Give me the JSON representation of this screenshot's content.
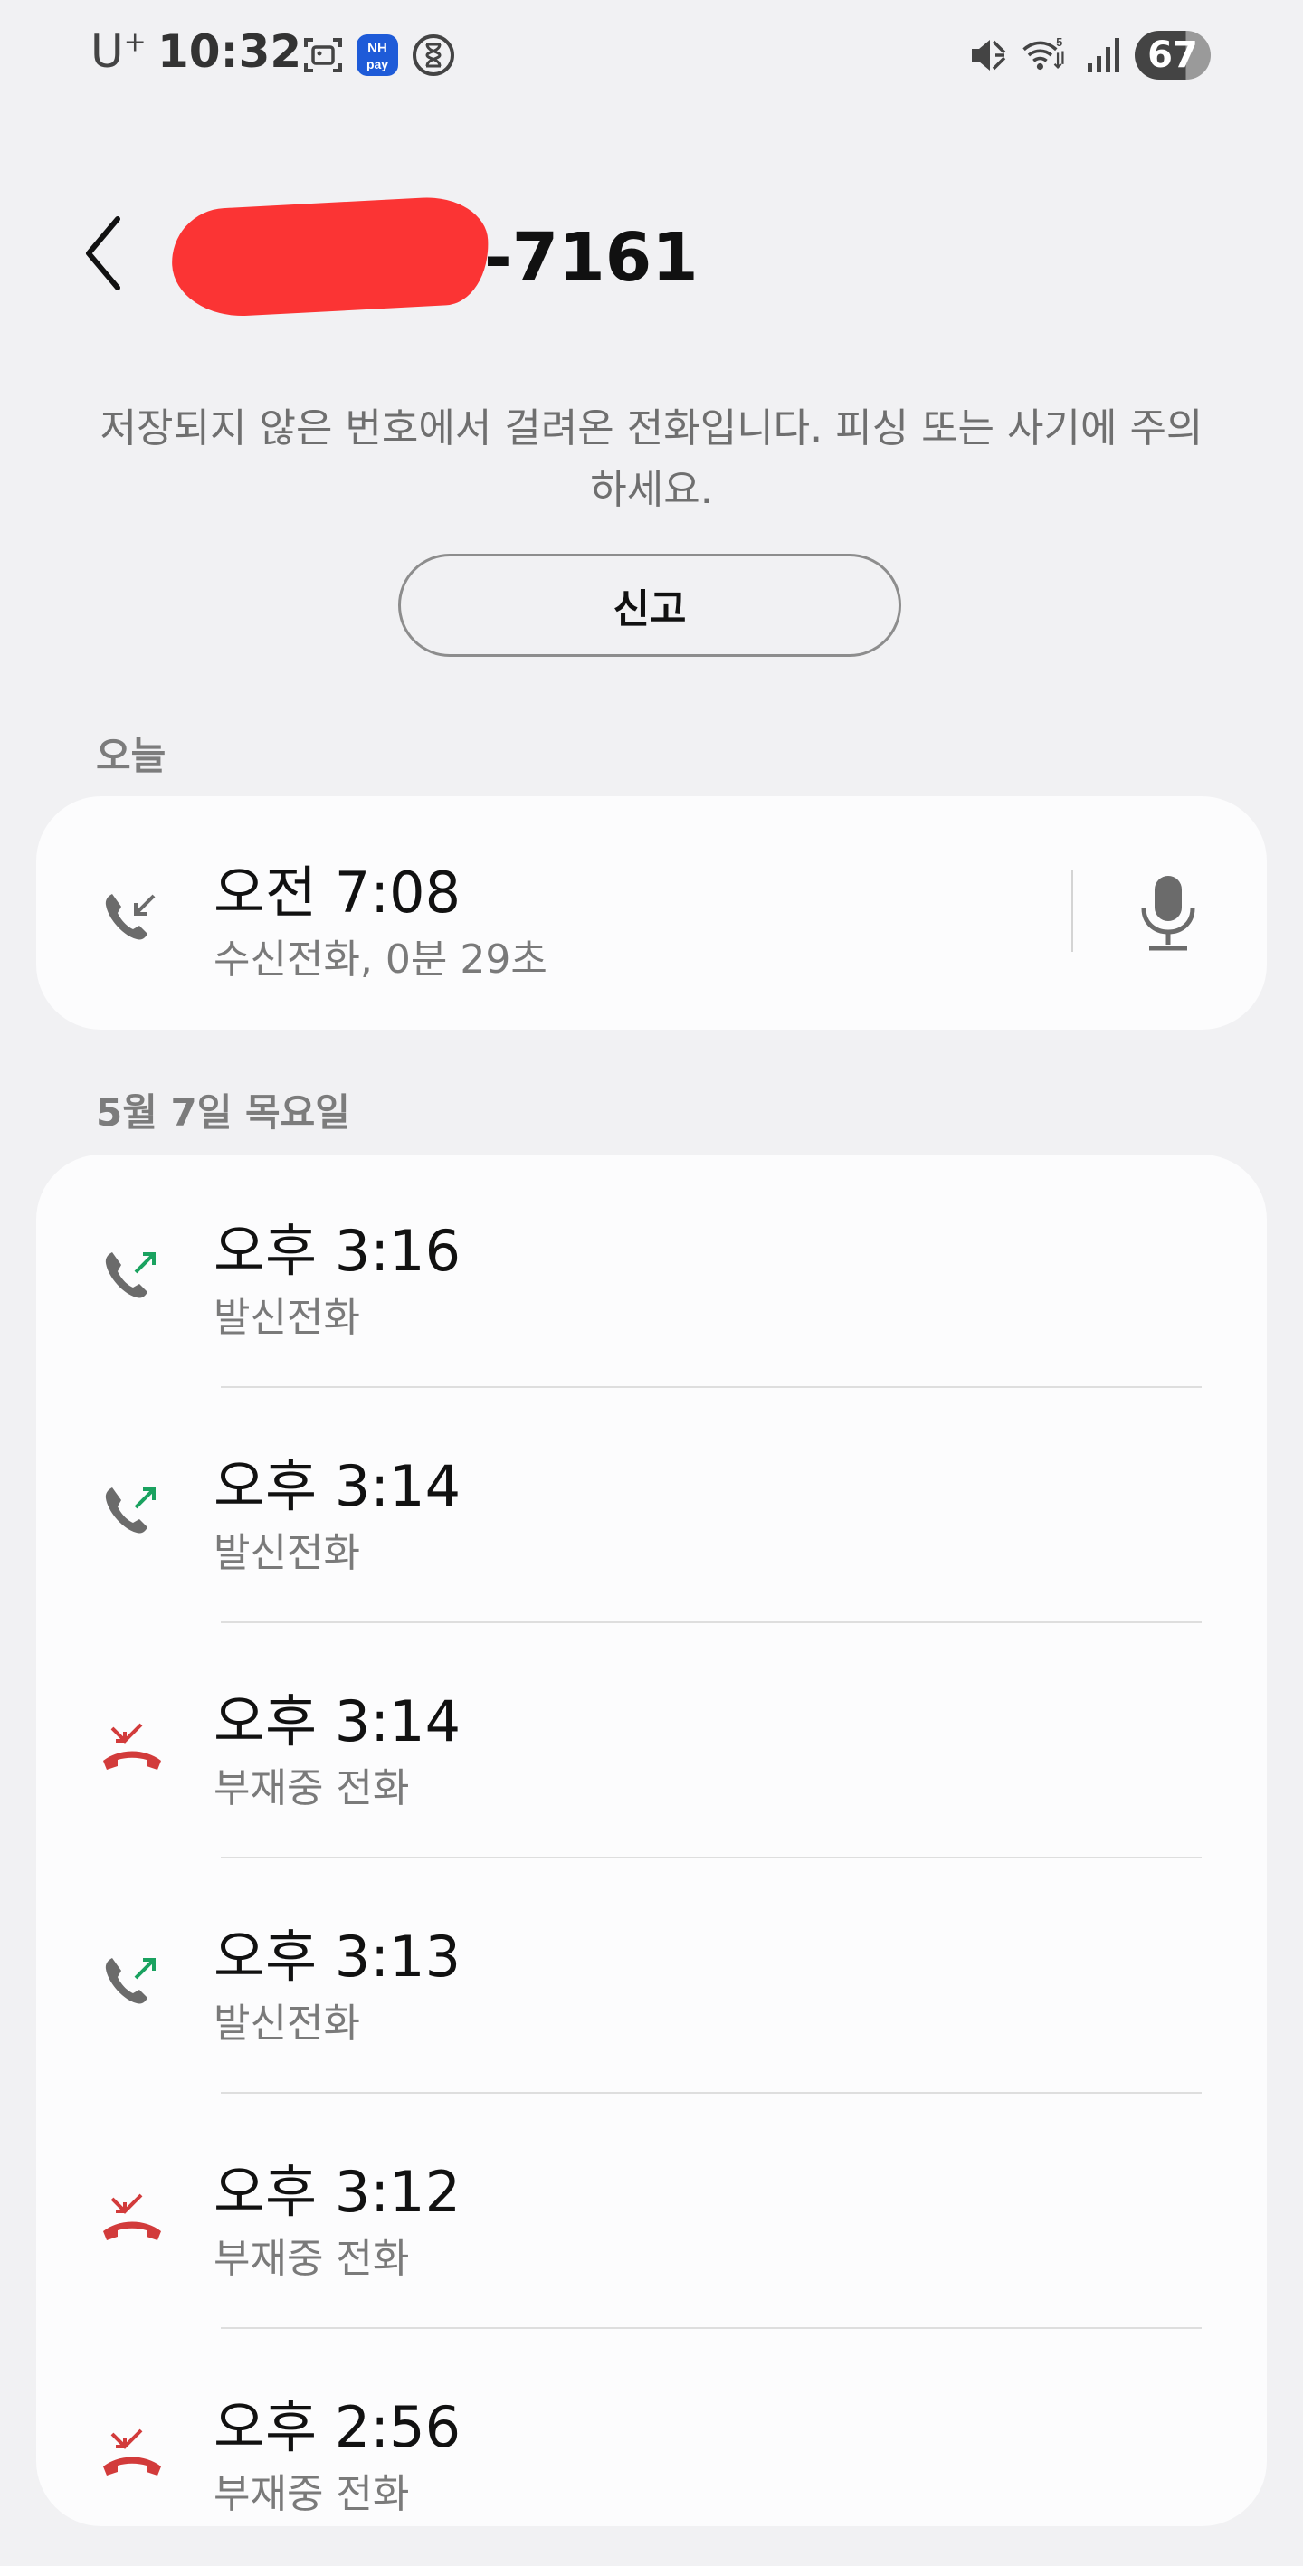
{
  "status_bar": {
    "carrier": "U",
    "carrier_sup": "+",
    "time": "10:32",
    "battery": "67",
    "icons": [
      "screenshot-icon",
      "nh-pay-icon",
      "hourglass-icon",
      "mute-icon",
      "wifi-icon",
      "signal-icon",
      "battery-icon"
    ]
  },
  "header": {
    "back_icon": "chevron-left-icon",
    "number_suffix": "-7161"
  },
  "warning_text": "저장되지 않은 번호에서 걸려온 전화입니다. 피싱 또는 사기에 주의하세요.",
  "report_button": "신고",
  "sections": [
    {
      "label": "오늘",
      "calls": [
        {
          "time": "오전 7:08",
          "type": "수신전화, 0분 29초",
          "kind": "incoming",
          "recording": true
        }
      ]
    },
    {
      "label": "5월 7일 목요일",
      "calls": [
        {
          "time": "오후 3:16",
          "type": "발신전화",
          "kind": "outgoing"
        },
        {
          "time": "오후 3:14",
          "type": "발신전화",
          "kind": "outgoing"
        },
        {
          "time": "오후 3:14",
          "type": "부재중 전화",
          "kind": "missed"
        },
        {
          "time": "오후 3:13",
          "type": "발신전화",
          "kind": "outgoing"
        },
        {
          "time": "오후 3:12",
          "type": "부재중 전화",
          "kind": "missed"
        },
        {
          "time": "오후 2:56",
          "type": "부재중 전화",
          "kind": "missed"
        }
      ]
    }
  ],
  "colors": {
    "outgoing_arrow": "#1aa260",
    "missed": "#d23b3b",
    "phone_gray": "#6b6b6b"
  }
}
